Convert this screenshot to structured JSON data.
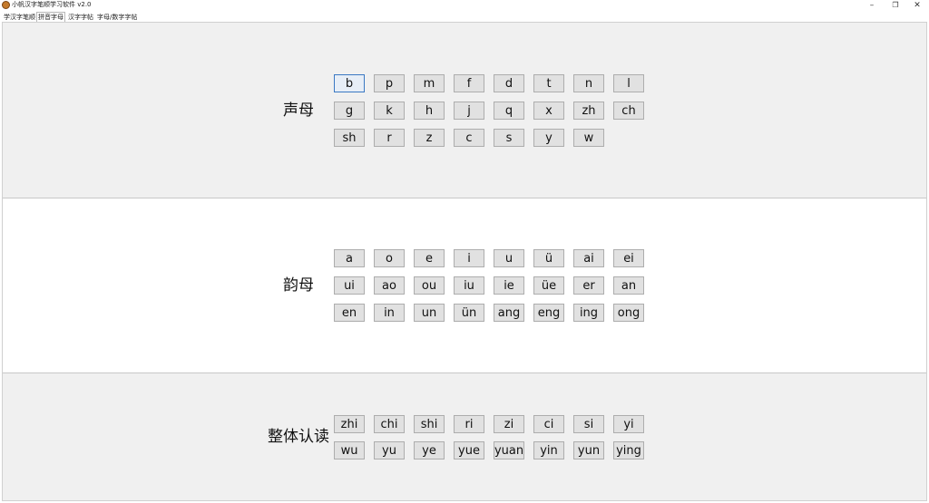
{
  "window": {
    "title": "小帆汉字笔顺学习软件 v2.0",
    "controls": {
      "minimize": "–",
      "maximize": "❐",
      "close": "✕"
    }
  },
  "tabs": [
    {
      "label": "学汉字笔顺",
      "active": false
    },
    {
      "label": "拼音字母",
      "active": true
    },
    {
      "label": "汉字字帖",
      "active": false
    },
    {
      "label": "字母/数字字帖",
      "active": false
    }
  ],
  "sections": {
    "shengmu": {
      "title": "声母",
      "rows": [
        [
          "b",
          "p",
          "m",
          "f",
          "d",
          "t",
          "n",
          "l"
        ],
        [
          "g",
          "k",
          "h",
          "j",
          "q",
          "x",
          "zh",
          "ch"
        ],
        [
          "sh",
          "r",
          "z",
          "c",
          "s",
          "y",
          "w"
        ]
      ],
      "focused": "b"
    },
    "yunmu": {
      "title": "韵母",
      "rows": [
        [
          "a",
          "o",
          "e",
          "i",
          "u",
          "ü",
          "ai",
          "ei"
        ],
        [
          "ui",
          "ao",
          "ou",
          "iu",
          "ie",
          "üe",
          "er",
          "an"
        ],
        [
          "en",
          "in",
          "un",
          "ün",
          "ang",
          "eng",
          "ing",
          "ong"
        ]
      ]
    },
    "zhengti": {
      "title": "整体认读",
      "rows": [
        [
          "zhi",
          "chi",
          "shi",
          "ri",
          "zi",
          "ci",
          "si",
          "yi"
        ],
        [
          "wu",
          "yu",
          "ye",
          "yue",
          "yuan",
          "yin",
          "yun",
          "ying"
        ]
      ]
    }
  }
}
